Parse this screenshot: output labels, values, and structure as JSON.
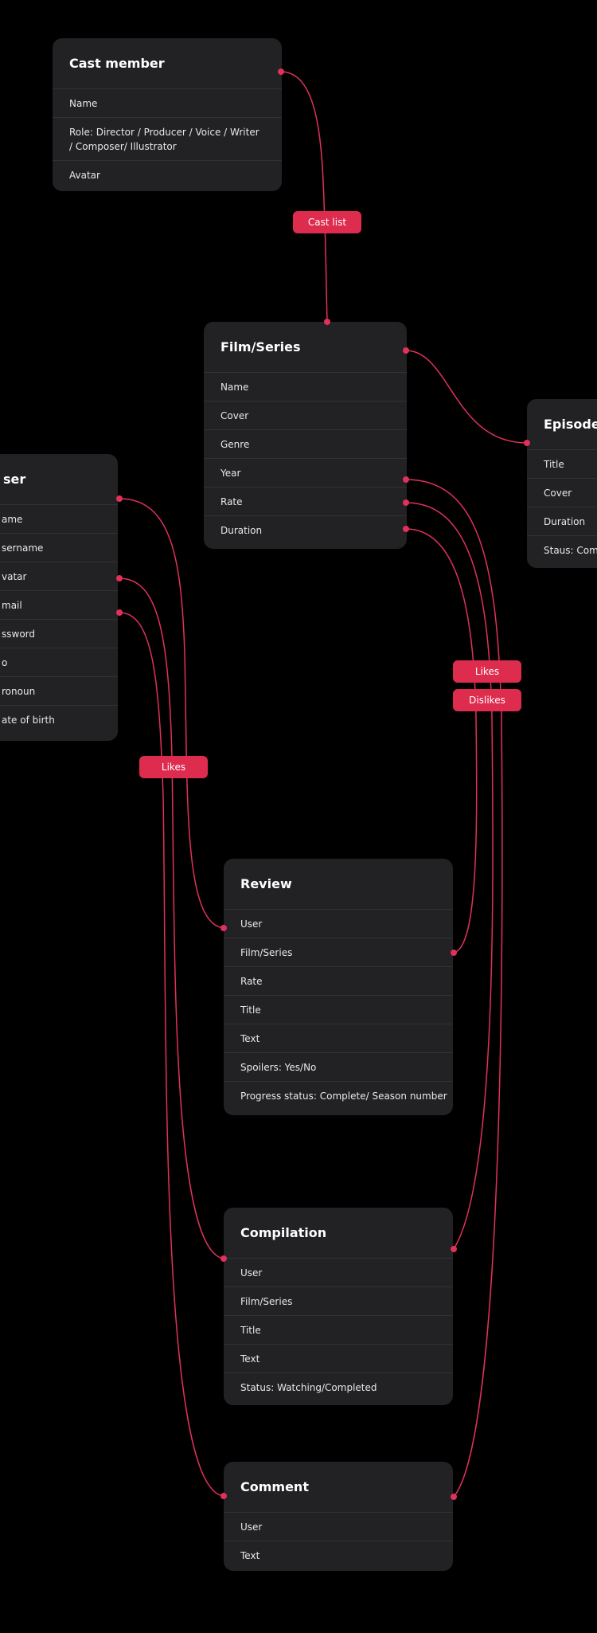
{
  "accent_color": "#e0315a",
  "entities": {
    "cast_member": {
      "title": "Cast member",
      "fields": [
        "Name",
        "Role: Director / Producer / Voice / Writer / Composer/  Illustrator",
        "Avatar"
      ]
    },
    "film_series": {
      "title": "Film/Series",
      "fields": [
        "Name",
        "Cover",
        "Genre",
        "Year",
        "Rate",
        "Duration"
      ]
    },
    "episode": {
      "title": "Episode",
      "fields": [
        "Title",
        "Cover",
        "Duration",
        "Staus: Comp"
      ]
    },
    "user": {
      "title": "ser",
      "fields": [
        "ame",
        "sername",
        "vatar",
        "mail",
        "ssword",
        "o",
        "ronoun",
        "ate of birth"
      ]
    },
    "review": {
      "title": "Review",
      "fields": [
        "User",
        "Film/Series",
        "Rate",
        "Title",
        "Text",
        "Spoilers: Yes/No",
        "Progress status: Complete/ Season number"
      ]
    },
    "compilation": {
      "title": "Compilation",
      "fields": [
        "User",
        "Film/Series",
        "Title",
        "Text",
        "Status: Watching/Completed"
      ]
    },
    "comment": {
      "title": "Comment",
      "fields": [
        "User",
        "Text"
      ]
    }
  },
  "relations": {
    "cast_list": "Cast list",
    "likes_film": "Likes",
    "dislikes_film": "Dislikes",
    "likes_user": "Likes"
  }
}
